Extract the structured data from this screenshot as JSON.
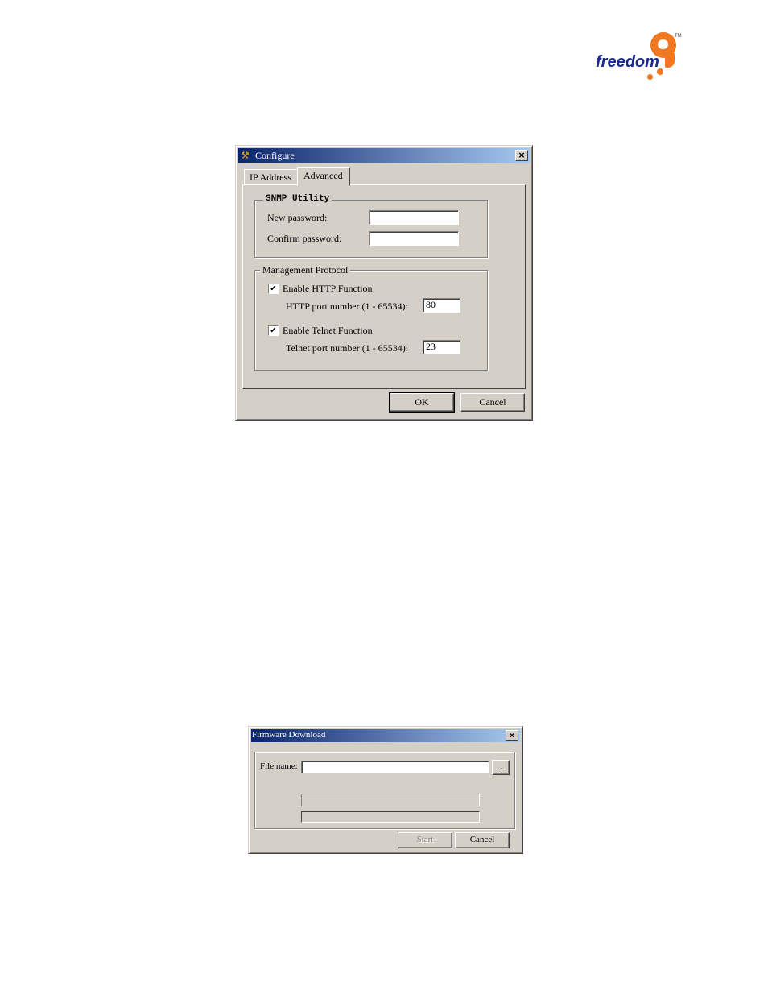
{
  "logo": {
    "text": "freedom",
    "mark": "9",
    "tm": "TM",
    "colors": {
      "text": "#1a2a8a",
      "mark": "#f07820"
    }
  },
  "configure": {
    "title": "Configure",
    "icon": "hammer-icon",
    "tabs": [
      {
        "label": "IP Address",
        "active": false
      },
      {
        "label": "Advanced",
        "active": true
      }
    ],
    "snmp": {
      "legend": "SNMP Utility",
      "new_password_label": "New password:",
      "new_password_value": "",
      "confirm_password_label": "Confirm password:",
      "confirm_password_value": ""
    },
    "mgmt": {
      "legend": "Management Protocol",
      "http_label": "Enable HTTP Function",
      "http_checked": true,
      "http_port_label": "HTTP port number (1 - 65534):",
      "http_port": "80",
      "telnet_label": "Enable Telnet Function",
      "telnet_checked": true,
      "telnet_port_label": "Telnet port number (1 - 65534):",
      "telnet_port": "23"
    },
    "ok": "OK",
    "cancel": "Cancel"
  },
  "firmware": {
    "title": "Firmware Download",
    "file_label": "File name:",
    "file_value": "",
    "browse": "...",
    "start": "Start",
    "cancel": "Cancel"
  }
}
